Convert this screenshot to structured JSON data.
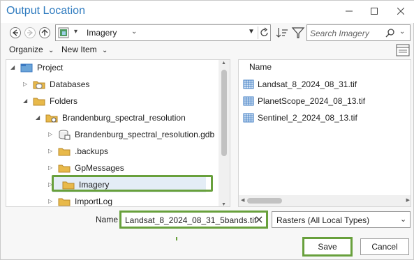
{
  "window": {
    "title": "Output Location"
  },
  "navigation": {
    "address_value": "Imagery",
    "search_placeholder": "Search Imagery"
  },
  "toolbar": {
    "organize_label": "Organize",
    "new_item_label": "New Item"
  },
  "tree": {
    "items": [
      {
        "label": "Project",
        "icon": "project-icon",
        "level": 0,
        "expanded": true
      },
      {
        "label": "Databases",
        "icon": "database-folder-icon",
        "level": 1,
        "expanded": false
      },
      {
        "label": "Folders",
        "icon": "folder-icon",
        "level": 1,
        "expanded": true
      },
      {
        "label": "Brandenburg_spectral_resolution",
        "icon": "folder-connection-icon",
        "level": 2,
        "expanded": true
      },
      {
        "label": "Brandenburg_spectral_resolution.gdb",
        "icon": "geodatabase-icon",
        "level": 3,
        "expanded": false
      },
      {
        "label": ".backups",
        "icon": "folder-icon",
        "level": 3,
        "expanded": false
      },
      {
        "label": "GpMessages",
        "icon": "folder-icon",
        "level": 3,
        "expanded": false
      },
      {
        "label": "Imagery",
        "icon": "folder-icon",
        "level": 3,
        "expanded": false,
        "selected": true
      },
      {
        "label": "ImportLog",
        "icon": "folder-icon",
        "level": 3,
        "expanded": false
      }
    ]
  },
  "contents": {
    "column_header": "Name",
    "files": [
      {
        "label": "Landsat_8_2024_08_31.tif",
        "icon": "raster-icon"
      },
      {
        "label": "PlanetScope_2024_08_13.tif",
        "icon": "raster-icon"
      },
      {
        "label": "Sentinel_2_2024_08_13.tif",
        "icon": "raster-icon"
      }
    ]
  },
  "footer": {
    "name_label": "Name",
    "name_value": "Landsat_8_2024_08_31_5bands.tif",
    "type_value": "Rasters (All Local Types)",
    "save_label": "Save",
    "cancel_label": "Cancel"
  },
  "colors": {
    "title": "#2f7bbf",
    "highlight": "#68a03c",
    "folder": "#e8b94a",
    "raster": "#3a78c2"
  }
}
